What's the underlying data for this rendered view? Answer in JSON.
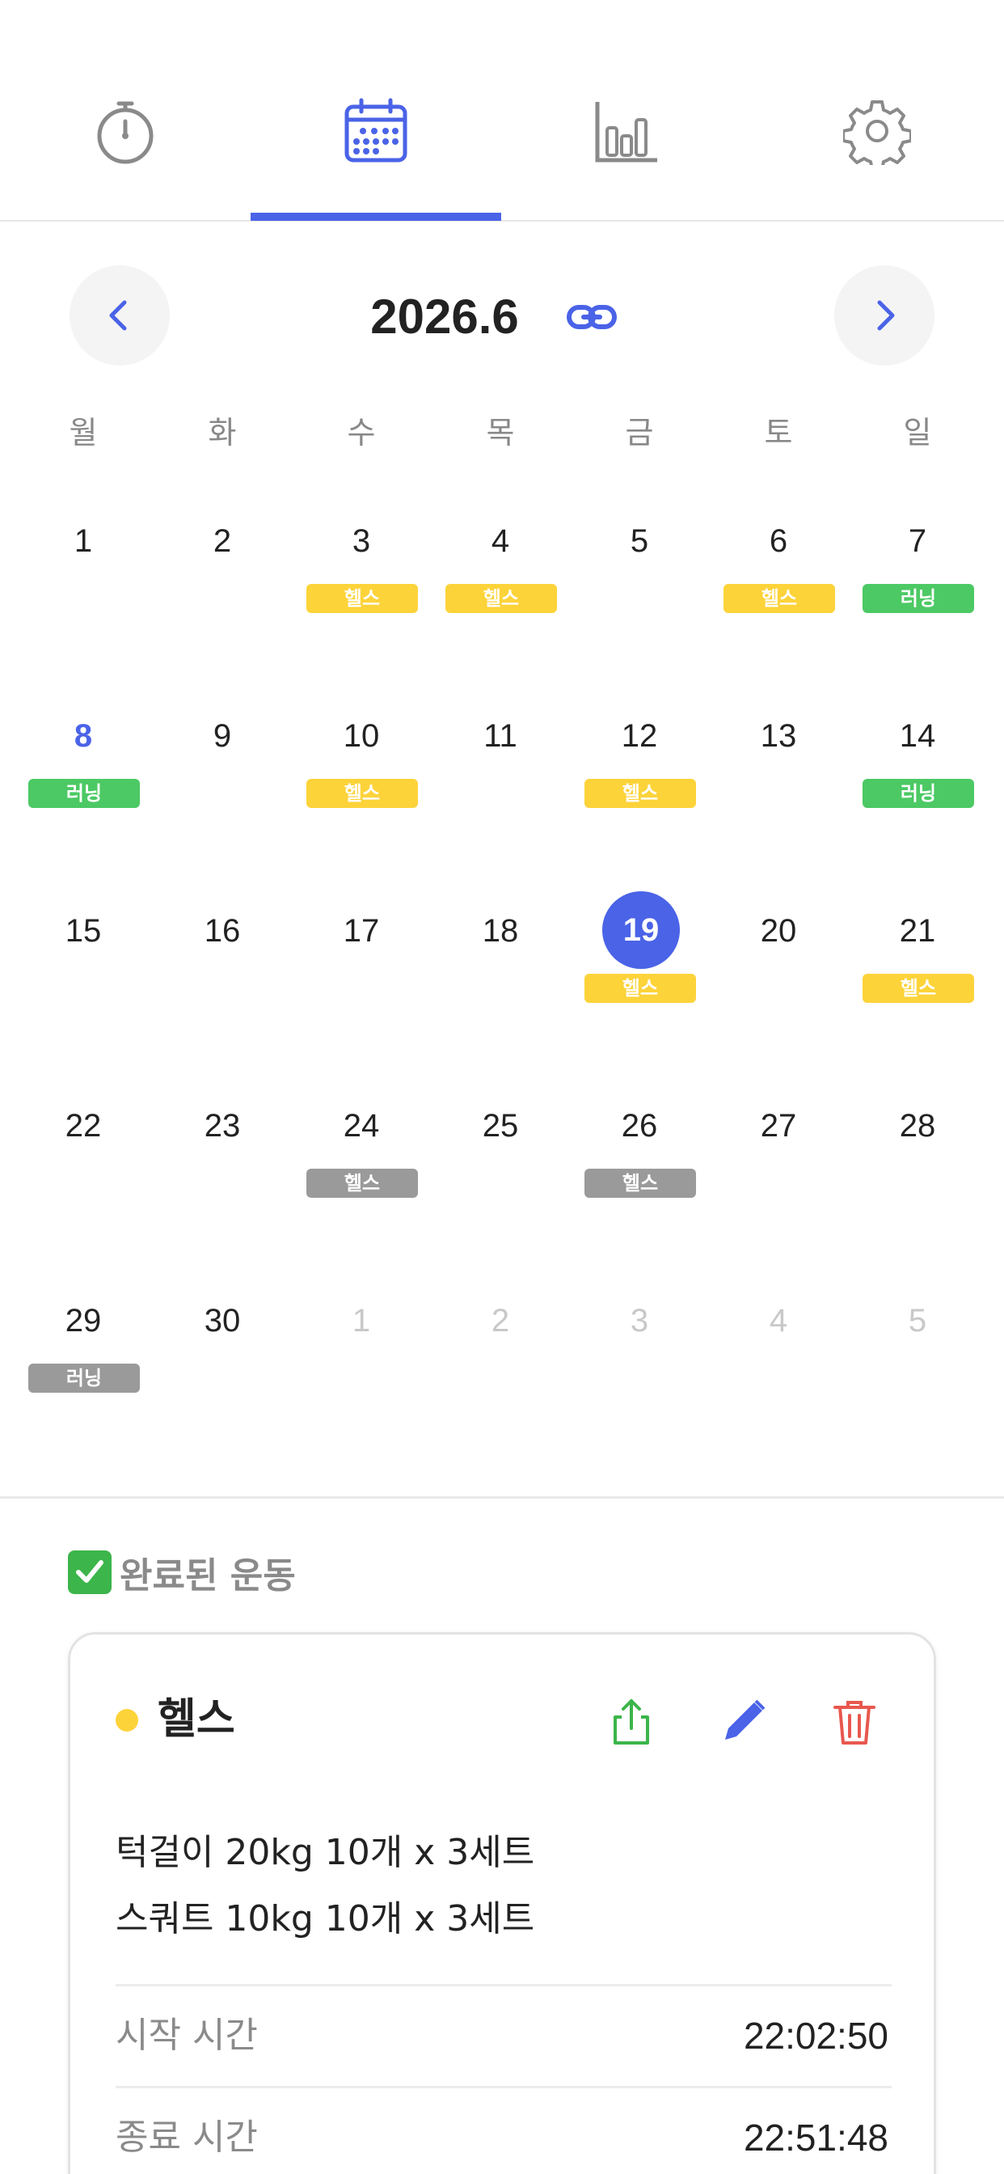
{
  "tabs": [
    {
      "icon": "stopwatch-icon",
      "active": false
    },
    {
      "icon": "calendar-icon",
      "active": true
    },
    {
      "icon": "bar-chart-icon",
      "active": false
    },
    {
      "icon": "gear-icon",
      "active": false
    }
  ],
  "colors": {
    "accent": "#4a63e7",
    "health": "#fdd33a",
    "running": "#4cc964",
    "planned": "#9a9a9a",
    "share": "#3cb54a",
    "edit": "#4a63e7",
    "delete": "#e8584f"
  },
  "calendar": {
    "title": "2026.6",
    "prev_icon": "chevron-left-icon",
    "next_icon": "chevron-right-icon",
    "link_icon": "link-icon",
    "weekdays": [
      "월",
      "화",
      "수",
      "목",
      "금",
      "토",
      "일"
    ],
    "weeks": [
      [
        {
          "day": "1"
        },
        {
          "day": "2"
        },
        {
          "day": "3",
          "badge": "헬스",
          "kind": "health"
        },
        {
          "day": "4",
          "badge": "헬스",
          "kind": "health"
        },
        {
          "day": "5"
        },
        {
          "day": "6",
          "badge": "헬스",
          "kind": "health"
        },
        {
          "day": "7",
          "badge": "러닝",
          "kind": "running"
        }
      ],
      [
        {
          "day": "8",
          "badge": "러닝",
          "kind": "running",
          "holiday": true
        },
        {
          "day": "9"
        },
        {
          "day": "10",
          "badge": "헬스",
          "kind": "health"
        },
        {
          "day": "11"
        },
        {
          "day": "12",
          "badge": "헬스",
          "kind": "health"
        },
        {
          "day": "13"
        },
        {
          "day": "14",
          "badge": "러닝",
          "kind": "running"
        }
      ],
      [
        {
          "day": "15"
        },
        {
          "day": "16"
        },
        {
          "day": "17"
        },
        {
          "day": "18"
        },
        {
          "day": "19",
          "badge": "헬스",
          "kind": "health",
          "today": true
        },
        {
          "day": "20"
        },
        {
          "day": "21",
          "badge": "헬스",
          "kind": "health"
        }
      ],
      [
        {
          "day": "22"
        },
        {
          "day": "23"
        },
        {
          "day": "24",
          "badge": "헬스",
          "kind": "planned"
        },
        {
          "day": "25"
        },
        {
          "day": "26",
          "badge": "헬스",
          "kind": "planned"
        },
        {
          "day": "27"
        },
        {
          "day": "28"
        }
      ],
      [
        {
          "day": "29",
          "badge": "러닝",
          "kind": "planned"
        },
        {
          "day": "30"
        },
        {
          "day": "1",
          "other": true
        },
        {
          "day": "2",
          "other": true
        },
        {
          "day": "3",
          "other": true
        },
        {
          "day": "4",
          "other": true
        },
        {
          "day": "5",
          "other": true
        }
      ]
    ]
  },
  "completed": {
    "section_title": "완료된 운동",
    "check_icon": "check-box-icon",
    "card": {
      "title": "헬스",
      "share_icon": "share-icon",
      "edit_icon": "pencil-icon",
      "delete_icon": "trash-icon",
      "exercises": [
        "턱걸이 20kg 10개 x 3세트",
        "스쿼트 10kg 10개 x 3세트"
      ],
      "start_label": "시작 시간",
      "start_value": "22:02:50",
      "end_label": "종료 시간",
      "end_value": "22:51:48"
    }
  }
}
